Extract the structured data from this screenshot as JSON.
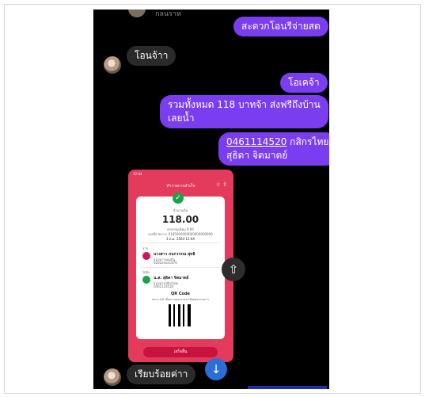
{
  "top_stub": {
    "name": "กลนราห"
  },
  "messages": {
    "sent_1": "สะดวกโอนรีจ่ายสด",
    "recv_1": "โอนจ้าา",
    "sent_2": "โอเคจ้า",
    "sent_3_line1": "รวมทั้งหมด 118 บาทจ้า ส่งฟรีถึงบ้าน",
    "sent_3_line2": "เลยน้ำ",
    "sent_4_account": "0461114520",
    "sent_4_bank": " กสิกรไทย",
    "sent_4_name": "สุธิดา จิตมาตย์",
    "recv_2": "เรียบร้อยค่าา"
  },
  "slip": {
    "status_time": "12:44",
    "header_title": "ทำรายการสำเร็จ",
    "amount_label": "จำนวนเงิน",
    "amount": "118.00",
    "fee_label": "ค่าธรรมเนียม 0.00",
    "ref_label": "เลขที่รายการ: 0165000000000000000000",
    "date": "3 ต.ค. 2564   12:44",
    "from_label": "จาก",
    "from_name": "นางสาว ถนกวรรณ สุทธิ",
    "from_bank": "ธนาคารออมสิน",
    "from_account": "0202xxxx1876",
    "to_label": "ไปยัง",
    "to_name": "น.ส. สุธิดา จิตมาตย์",
    "to_bank": "ธนาคารกสิกรไทย",
    "to_account": "0461114520",
    "qr_title": "QR Code",
    "qr_note": "สแกน QR เพื่อตรวจสอบรายละเอียดของรายการ",
    "done_button": "เสร็จสิ้น"
  },
  "colors": {
    "sent_bubble": "#7a3df0",
    "recv_bubble": "#2a2a2a",
    "slip_brand": "#e43a5b",
    "scroll_button": "#2a6fd8"
  },
  "icons": {
    "share": "share-icon",
    "scroll_down": "arrow-down-icon",
    "star": "star-icon",
    "export": "export-icon"
  }
}
